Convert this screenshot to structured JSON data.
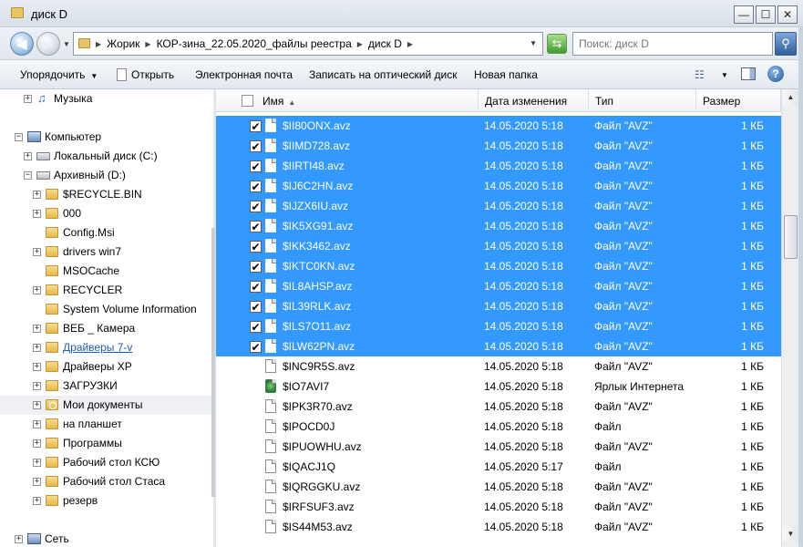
{
  "window": {
    "title": "диск D",
    "min_glyph": "—",
    "max_glyph": "☐",
    "close_glyph": "✕"
  },
  "address": {
    "breadcrumbs": [
      "Жорик",
      "КОР-зина_22.05.2020_файлы реестра",
      "диск D"
    ],
    "search_placeholder": "Поиск: диск D"
  },
  "toolbar": {
    "organize": "Упорядочить",
    "open": "Открыть",
    "email": "Электронная почта",
    "burn": "Записать на оптический диск",
    "new_folder": "Новая папка"
  },
  "nav": {
    "music": "Музыка",
    "computer": "Компьютер",
    "local_disk": "Локальный диск (C:)",
    "archive_disk": "Архивный (D:)",
    "folders": [
      "$RECYCLE.BIN",
      "000",
      "Config.Msi",
      "drivers win7",
      "MSOCache",
      "RECYCLER",
      "System Volume Information",
      "ВЕБ _ Камера",
      "Драйверы 7-v",
      "Драйверы XP",
      "ЗАГРУЗКИ",
      "Мои документы",
      "на планшет",
      "Программы",
      "Рабочий стол КСЮ",
      "Рабочий стол Стаса",
      "резерв"
    ],
    "network": "Сеть"
  },
  "columns": {
    "name": "Имя",
    "date": "Дата изменения",
    "type": "Тип",
    "size": "Размер"
  },
  "files": [
    {
      "name": "$II80ONX.avz",
      "date": "14.05.2020 5:18",
      "type": "Файл \"AVZ\"",
      "size": "1 КБ",
      "selected": true
    },
    {
      "name": "$IIMD728.avz",
      "date": "14.05.2020 5:18",
      "type": "Файл \"AVZ\"",
      "size": "1 КБ",
      "selected": true
    },
    {
      "name": "$IIRTI48.avz",
      "date": "14.05.2020 5:18",
      "type": "Файл \"AVZ\"",
      "size": "1 КБ",
      "selected": true
    },
    {
      "name": "$IJ6C2HN.avz",
      "date": "14.05.2020 5:18",
      "type": "Файл \"AVZ\"",
      "size": "1 КБ",
      "selected": true
    },
    {
      "name": "$IJZX6IU.avz",
      "date": "14.05.2020 5:18",
      "type": "Файл \"AVZ\"",
      "size": "1 КБ",
      "selected": true
    },
    {
      "name": "$IK5XG91.avz",
      "date": "14.05.2020 5:18",
      "type": "Файл \"AVZ\"",
      "size": "1 КБ",
      "selected": true
    },
    {
      "name": "$IKK3462.avz",
      "date": "14.05.2020 5:18",
      "type": "Файл \"AVZ\"",
      "size": "1 КБ",
      "selected": true
    },
    {
      "name": "$IKTC0KN.avz",
      "date": "14.05.2020 5:18",
      "type": "Файл \"AVZ\"",
      "size": "1 КБ",
      "selected": true
    },
    {
      "name": "$IL8AHSP.avz",
      "date": "14.05.2020 5:18",
      "type": "Файл \"AVZ\"",
      "size": "1 КБ",
      "selected": true
    },
    {
      "name": "$IL39RLK.avz",
      "date": "14.05.2020 5:18",
      "type": "Файл \"AVZ\"",
      "size": "1 КБ",
      "selected": true
    },
    {
      "name": "$ILS7O11.avz",
      "date": "14.05.2020 5:18",
      "type": "Файл \"AVZ\"",
      "size": "1 КБ",
      "selected": true
    },
    {
      "name": "$ILW62PN.avz",
      "date": "14.05.2020 5:18",
      "type": "Файл \"AVZ\"",
      "size": "1 КБ",
      "selected": true
    },
    {
      "name": "$INC9R5S.avz",
      "date": "14.05.2020 5:18",
      "type": "Файл \"AVZ\"",
      "size": "1 КБ",
      "selected": false
    },
    {
      "name": "$IO7AVI7",
      "date": "14.05.2020 5:18",
      "type": "Ярлык Интернета",
      "size": "1 КБ",
      "selected": false,
      "icon": "internet-shortcut"
    },
    {
      "name": "$IPK3R70.avz",
      "date": "14.05.2020 5:18",
      "type": "Файл \"AVZ\"",
      "size": "1 КБ",
      "selected": false
    },
    {
      "name": "$IPOCD0J",
      "date": "14.05.2020 5:18",
      "type": "Файл",
      "size": "1 КБ",
      "selected": false
    },
    {
      "name": "$IPUOWHU.avz",
      "date": "14.05.2020 5:18",
      "type": "Файл \"AVZ\"",
      "size": "1 КБ",
      "selected": false
    },
    {
      "name": "$IQACJ1Q",
      "date": "14.05.2020 5:17",
      "type": "Файл",
      "size": "1 КБ",
      "selected": false
    },
    {
      "name": "$IQRGGKU.avz",
      "date": "14.05.2020 5:18",
      "type": "Файл \"AVZ\"",
      "size": "1 КБ",
      "selected": false
    },
    {
      "name": "$IRFSUF3.avz",
      "date": "14.05.2020 5:18",
      "type": "Файл \"AVZ\"",
      "size": "1 КБ",
      "selected": false
    },
    {
      "name": "$IS44M53.avz",
      "date": "14.05.2020 5:18",
      "type": "Файл \"AVZ\"",
      "size": "1 КБ",
      "selected": false
    }
  ]
}
